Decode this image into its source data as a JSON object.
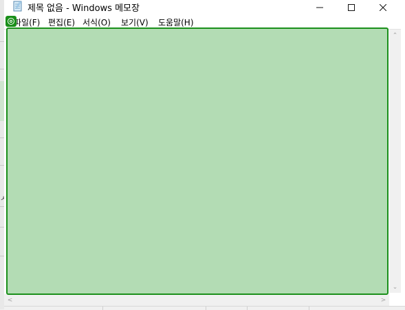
{
  "window": {
    "title": "제목 없음 - Windows 메모장",
    "icon": "notepad-icon"
  },
  "controls": {
    "minimize_icon": "minimize-icon",
    "maximize_icon": "maximize-icon",
    "close_icon": "close-icon"
  },
  "menu": {
    "items": [
      {
        "label": "파일(F)"
      },
      {
        "label": "편집(E)"
      },
      {
        "label": "서식(O)"
      },
      {
        "label": "보기(V)"
      },
      {
        "label": "도움말(H)"
      }
    ]
  },
  "editor": {
    "content": ""
  },
  "colors": {
    "highlight_fill": "#b3dcb4",
    "highlight_border": "#1a8f1a"
  }
}
